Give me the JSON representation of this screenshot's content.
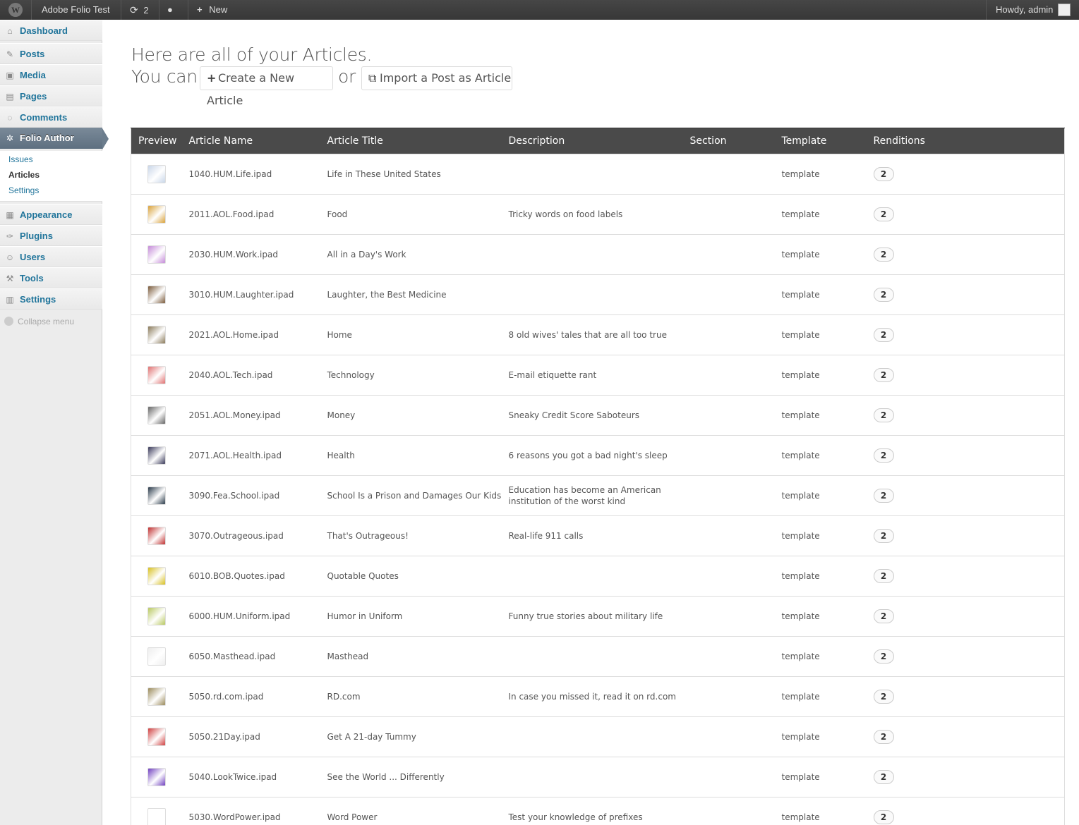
{
  "admin_bar": {
    "site_name": "Adobe Folio Test",
    "updates_count": "2",
    "new_label": "New",
    "howdy": "Howdy, admin"
  },
  "sidebar": {
    "items": [
      {
        "key": "dashboard",
        "label": "Dashboard",
        "icon": "home-icon",
        "glyph": "⌂"
      },
      {
        "key": "posts",
        "label": "Posts",
        "icon": "pushpin-icon",
        "glyph": "✎"
      },
      {
        "key": "media",
        "label": "Media",
        "icon": "media-icon",
        "glyph": "▣"
      },
      {
        "key": "pages",
        "label": "Pages",
        "icon": "pages-icon",
        "glyph": "▤"
      },
      {
        "key": "comments",
        "label": "Comments",
        "icon": "comment-bubble-icon",
        "glyph": "◌"
      },
      {
        "key": "folio-author",
        "label": "Folio Author",
        "icon": "gear-icon",
        "glyph": "✲"
      },
      {
        "key": "appearance",
        "label": "Appearance",
        "icon": "appearance-icon",
        "glyph": "▦"
      },
      {
        "key": "plugins",
        "label": "Plugins",
        "icon": "plug-icon",
        "glyph": "✑"
      },
      {
        "key": "users",
        "label": "Users",
        "icon": "users-icon",
        "glyph": "☺"
      },
      {
        "key": "tools",
        "label": "Tools",
        "icon": "tools-icon",
        "glyph": "⚒"
      },
      {
        "key": "settings",
        "label": "Settings",
        "icon": "settings-icon",
        "glyph": "▥"
      }
    ],
    "submenu": [
      {
        "label": "Issues"
      },
      {
        "label": "Articles"
      },
      {
        "label": "Settings"
      }
    ],
    "collapse_label": "Collapse menu"
  },
  "heading": {
    "line1": "Here are all of your Articles.",
    "you_can": "You can",
    "create_label": "Create a New Article",
    "or": "or",
    "import_label": "Import a Post as Article"
  },
  "table": {
    "columns": [
      "Preview",
      "Article Name",
      "Article Title",
      "Description",
      "Section",
      "Template",
      "Renditions"
    ],
    "rows": [
      {
        "name": "1040.HUM.Life.ipad",
        "title": "Life  in These United States",
        "description": "",
        "section": "",
        "template": "template",
        "renditions": "2",
        "thumb_color": "#c9d6e8"
      },
      {
        "name": "2011.AOL.Food.ipad",
        "title": "Food",
        "description": "Tricky words on food labels",
        "section": "",
        "template": "template",
        "renditions": "2",
        "thumb_color": "#d9a23a"
      },
      {
        "name": "2030.HUM.Work.ipad",
        "title": "All in a Day's Work",
        "description": "",
        "section": "",
        "template": "template",
        "renditions": "2",
        "thumb_color": "#c48ad8"
      },
      {
        "name": "3010.HUM.Laughter.ipad",
        "title": "Laughter, the Best Medicine",
        "description": "",
        "section": "",
        "template": "template",
        "renditions": "2",
        "thumb_color": "#7a5a3a"
      },
      {
        "name": "2021.AOL.Home.ipad",
        "title": "Home",
        "description": "8 old wives' tales that are all too true",
        "section": "",
        "template": "template",
        "renditions": "2",
        "thumb_color": "#8a7a5a"
      },
      {
        "name": "2040.AOL.Tech.ipad",
        "title": "Technology",
        "description": "E-mail etiquette rant",
        "section": "",
        "template": "template",
        "renditions": "2",
        "thumb_color": "#e07070"
      },
      {
        "name": "2051.AOL.Money.ipad",
        "title": "Money",
        "description": "Sneaky Credit Score Saboteurs",
        "section": "",
        "template": "template",
        "renditions": "2",
        "thumb_color": "#666666"
      },
      {
        "name": "2071.AOL.Health.ipad",
        "title": "Health",
        "description": "6 reasons you got a bad night's sleep",
        "section": "",
        "template": "template",
        "renditions": "2",
        "thumb_color": "#3a3a5a"
      },
      {
        "name": "3090.Fea.School.ipad",
        "title": "School Is a Prison and Damages Our Kids",
        "description": "Education has become an American institution of the worst kind",
        "section": "",
        "template": "template",
        "renditions": "2",
        "thumb_color": "#2a3a4a"
      },
      {
        "name": "3070.Outrageous.ipad",
        "title": "That's Outrageous!",
        "description": "Real-life 911 calls",
        "section": "",
        "template": "template",
        "renditions": "2",
        "thumb_color": "#c03030"
      },
      {
        "name": "6010.BOB.Quotes.ipad",
        "title": "Quotable Quotes",
        "description": "",
        "section": "",
        "template": "template",
        "renditions": "2",
        "thumb_color": "#d8c020"
      },
      {
        "name": "6000.HUM.Uniform.ipad",
        "title": "Humor in Uniform",
        "description": "Funny true stories about military life",
        "section": "",
        "template": "template",
        "renditions": "2",
        "thumb_color": "#b8c860"
      },
      {
        "name": "6050.Masthead.ipad",
        "title": "Masthead",
        "description": "",
        "section": "",
        "template": "template",
        "renditions": "2",
        "thumb_color": "#eeeeee"
      },
      {
        "name": "5050.rd.com.ipad",
        "title": "RD.com",
        "description": "In case you missed it, read it on rd.com",
        "section": "",
        "template": "template",
        "renditions": "2",
        "thumb_color": "#9a8a5a"
      },
      {
        "name": "5050.21Day.ipad",
        "title": "Get A 21-day Tummy",
        "description": "",
        "section": "",
        "template": "template",
        "renditions": "2",
        "thumb_color": "#d04040"
      },
      {
        "name": "5040.LookTwice.ipad",
        "title": "See the World ... Differently",
        "description": "",
        "section": "",
        "template": "template",
        "renditions": "2",
        "thumb_color": "#7040c0"
      },
      {
        "name": "5030.WordPower.ipad",
        "title": "Word Power",
        "description": "Test your knowledge of prefixes",
        "section": "",
        "template": "template",
        "renditions": "2",
        "thumb_color": "#ffffff"
      }
    ]
  },
  "colors": {
    "link": "#21759b",
    "admin_bar": "#464646",
    "table_header": "#4a4a4a",
    "current_menu": "#6c7d8d"
  }
}
